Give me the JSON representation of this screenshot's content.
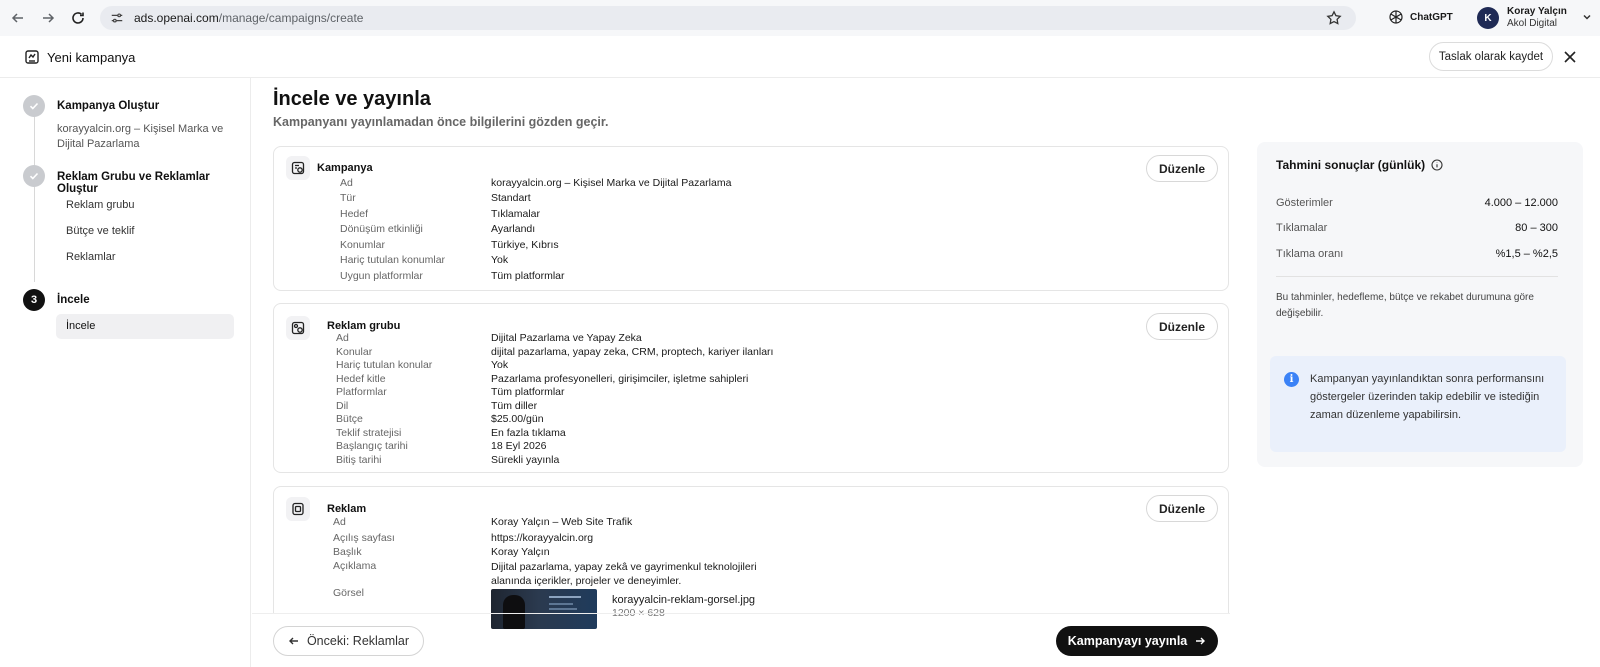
{
  "browser": {
    "url_host": "ads.openai.com",
    "url_path": "/manage/campaigns/create",
    "chatgpt_label": "ChatGPT",
    "account_initial": "K",
    "account_name": "Koray Yalçın",
    "account_org": "Akol Digital"
  },
  "header": {
    "title": "Yeni kampanya",
    "draft_label": "Taslak olarak kaydet"
  },
  "sidebar": {
    "step1": {
      "title": "Kampanya Oluştur",
      "subtitle_line1": "korayyalcin.org – Kişisel Marka ve",
      "subtitle_line2": "Dijital Pazarlama"
    },
    "step2": {
      "title": "Reklam Grubu ve Reklamlar Oluştur",
      "items": [
        "Reklam grubu",
        "Bütçe ve teklif",
        "Reklamlar"
      ]
    },
    "step3": {
      "number": "3",
      "title": "İncele",
      "items": [
        "İncele"
      ]
    }
  },
  "main": {
    "title": "İncele ve yayınla",
    "subtitle": "Kampanyanı yayınlamadan önce bilgilerini gözden geçir.",
    "edit_label": "Düzenle",
    "campaign": {
      "title": "Kampanya",
      "rows": [
        {
          "label": "Ad",
          "value": "korayyalcin.org – Kişisel Marka ve Dijital Pazarlama"
        },
        {
          "label": "Tür",
          "value": "Standart"
        },
        {
          "label": "Hedef",
          "value": "Tıklamalar"
        },
        {
          "label": "Dönüşüm etkinliği",
          "value": "Ayarlandı"
        },
        {
          "label": "Konumlar",
          "value": "Türkiye, Kıbrıs"
        },
        {
          "label": "Hariç tutulan konumlar",
          "value": "Yok"
        },
        {
          "label": "Uygun platformlar",
          "value": "Tüm platformlar"
        }
      ]
    },
    "adgroup": {
      "title": "Reklam grubu",
      "rows": [
        {
          "label": "Ad",
          "value": "Dijital Pazarlama ve Yapay Zeka"
        },
        {
          "label": "Konular",
          "value": "dijital pazarlama, yapay zeka, CRM, proptech, kariyer ilanları"
        },
        {
          "label": "Hariç tutulan konular",
          "value": "Yok"
        },
        {
          "label": "Hedef kitle",
          "value": "Pazarlama profesyonelleri, girişimciler, işletme sahipleri"
        },
        {
          "label": "Platformlar",
          "value": "Tüm platformlar"
        },
        {
          "label": "Dil",
          "value": "Tüm diller"
        },
        {
          "label": "Bütçe",
          "value": "$25.00/gün"
        },
        {
          "label": "Teklif stratejisi",
          "value": "En fazla tıklama"
        },
        {
          "label": "Başlangıç tarihi",
          "value": "18 Eyl 2026"
        },
        {
          "label": "Bitiş tarihi",
          "value": "Sürekli yayınla"
        }
      ]
    },
    "ad": {
      "title": "Reklam",
      "rows": [
        {
          "label": "Ad",
          "value": "Koray Yalçın – Web Site Trafik"
        },
        {
          "label": "Açılış sayfası",
          "value": "https://korayyalcin.org"
        },
        {
          "label": "Başlık",
          "value": "Koray Yalçın"
        }
      ],
      "description_label": "Açıklama",
      "description": "Dijital pazarlama, yapay zekâ ve gayrimenkul teknolojileri alanında içerikler, projeler ve deneyimler.",
      "image_label": "Görsel",
      "image_name": "korayyalcin-reklam-gorsel.jpg",
      "image_size": "1200 × 628"
    },
    "prev_label": "Önceki: Reklamlar",
    "publish_label": "Kampanyayı yayınla"
  },
  "estimates": {
    "title": "Tahmini sonuçlar (günlük)",
    "metrics": [
      {
        "label": "Gösterimler",
        "value": "4.000 – 12.000"
      },
      {
        "label": "Tıklamalar",
        "value": "80 – 300"
      },
      {
        "label": "Tıklama oranı",
        "value": "%1,5 – %2,5"
      }
    ],
    "note": "Bu tahminler, hedefleme, bütçe ve rekabet durumuna göre değişebilir.",
    "info": "Kampanyan yayınlandıktan sonra performansını göstergeler üzerinden takip edebilir ve istediğin zaman düzenleme yapabilirsin."
  },
  "colors": {
    "accent_dark": "#111111",
    "info_blue": "#3b82f6",
    "avatar_bg": "#1f2a55"
  }
}
